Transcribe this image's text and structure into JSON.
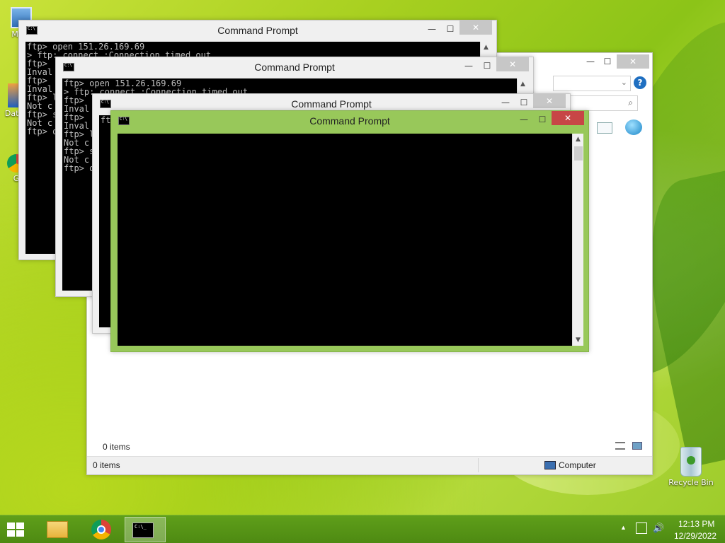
{
  "desktop": {
    "icons": [
      {
        "label": "My C"
      },
      {
        "label": "Data"
      },
      {
        "label": "G"
      },
      {
        "label": "Recycle Bin"
      }
    ]
  },
  "windows": {
    "cmd1": {
      "title": "Command Prompt",
      "lines": [
        "ftp> open 151.26.169.69",
        "> ftp: connect :Connection timed out",
        "ftp> ",
        "Inval",
        "ftp> ",
        "Inval",
        "ftp> l",
        "Not c",
        "ftp> s",
        "Not c",
        "ftp> q"
      ]
    },
    "cmd2": {
      "title": "Command Prompt",
      "lines": [
        "ftp> open 151.26.169.69",
        "> ftp: connect :Connection timed out",
        "ftp> ",
        "Inval",
        "ftp> ",
        "Inval",
        "ftp> l",
        "Not c",
        "ftp> s",
        "Not c",
        "ftp> q"
      ]
    },
    "cmd3": {
      "title": "Command Prompt",
      "lines": [
        "ft"
      ]
    },
    "cmd4": {
      "title": "Command Prompt",
      "lines": []
    },
    "explorer": {
      "items_count_text": "0 items",
      "status_left": "0 items",
      "status_right": "Computer"
    }
  },
  "controls": {
    "minimize": "—",
    "maximize": "☐",
    "close": "✕",
    "scroll_up": "▲",
    "scroll_down": "▼"
  },
  "taskbar": {
    "time": "12:13 PM",
    "date": "12/29/2022"
  },
  "colors": {
    "active_frame": "#98c85a",
    "close_active": "#c74646",
    "taskbar": "#4e8a12"
  }
}
